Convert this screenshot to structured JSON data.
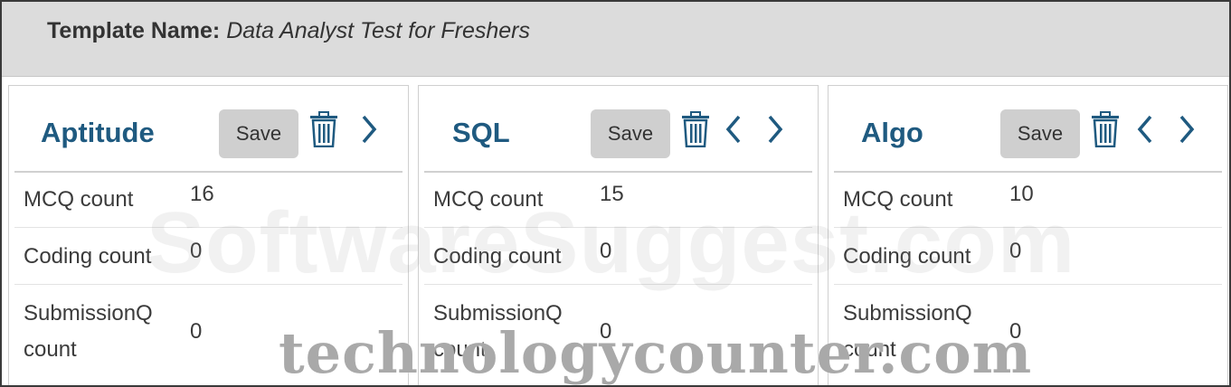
{
  "header": {
    "label": "Template Name:",
    "value": "Data Analyst Test for Freshers"
  },
  "panels": [
    {
      "title": "Aptitude",
      "save_label": "Save",
      "rows": [
        {
          "key": "MCQ count",
          "value": "16"
        },
        {
          "key": "Coding count",
          "value": "0"
        },
        {
          "key": "SubmissionQ count",
          "value": "0"
        }
      ]
    },
    {
      "title": "SQL",
      "save_label": "Save",
      "rows": [
        {
          "key": "MCQ count",
          "value": "15"
        },
        {
          "key": "Coding count",
          "value": "0"
        },
        {
          "key": "SubmissionQ count",
          "value": "0"
        }
      ]
    },
    {
      "title": "Algo",
      "save_label": "Save",
      "rows": [
        {
          "key": "MCQ count",
          "value": "10"
        },
        {
          "key": "Coding count",
          "value": "0"
        },
        {
          "key": "SubmissionQ count",
          "value": "0"
        }
      ]
    }
  ],
  "watermarks": {
    "primary": "SoftwareSuggest.com",
    "secondary": "technologycounter.com"
  },
  "icons": {
    "delete": "trash-icon",
    "previous": "chevron-left-icon",
    "next": "chevron-right-icon"
  },
  "colors": {
    "accent": "#1f5a80",
    "header_bg": "#dcdcdc",
    "save_bg": "#cfcfcf"
  }
}
